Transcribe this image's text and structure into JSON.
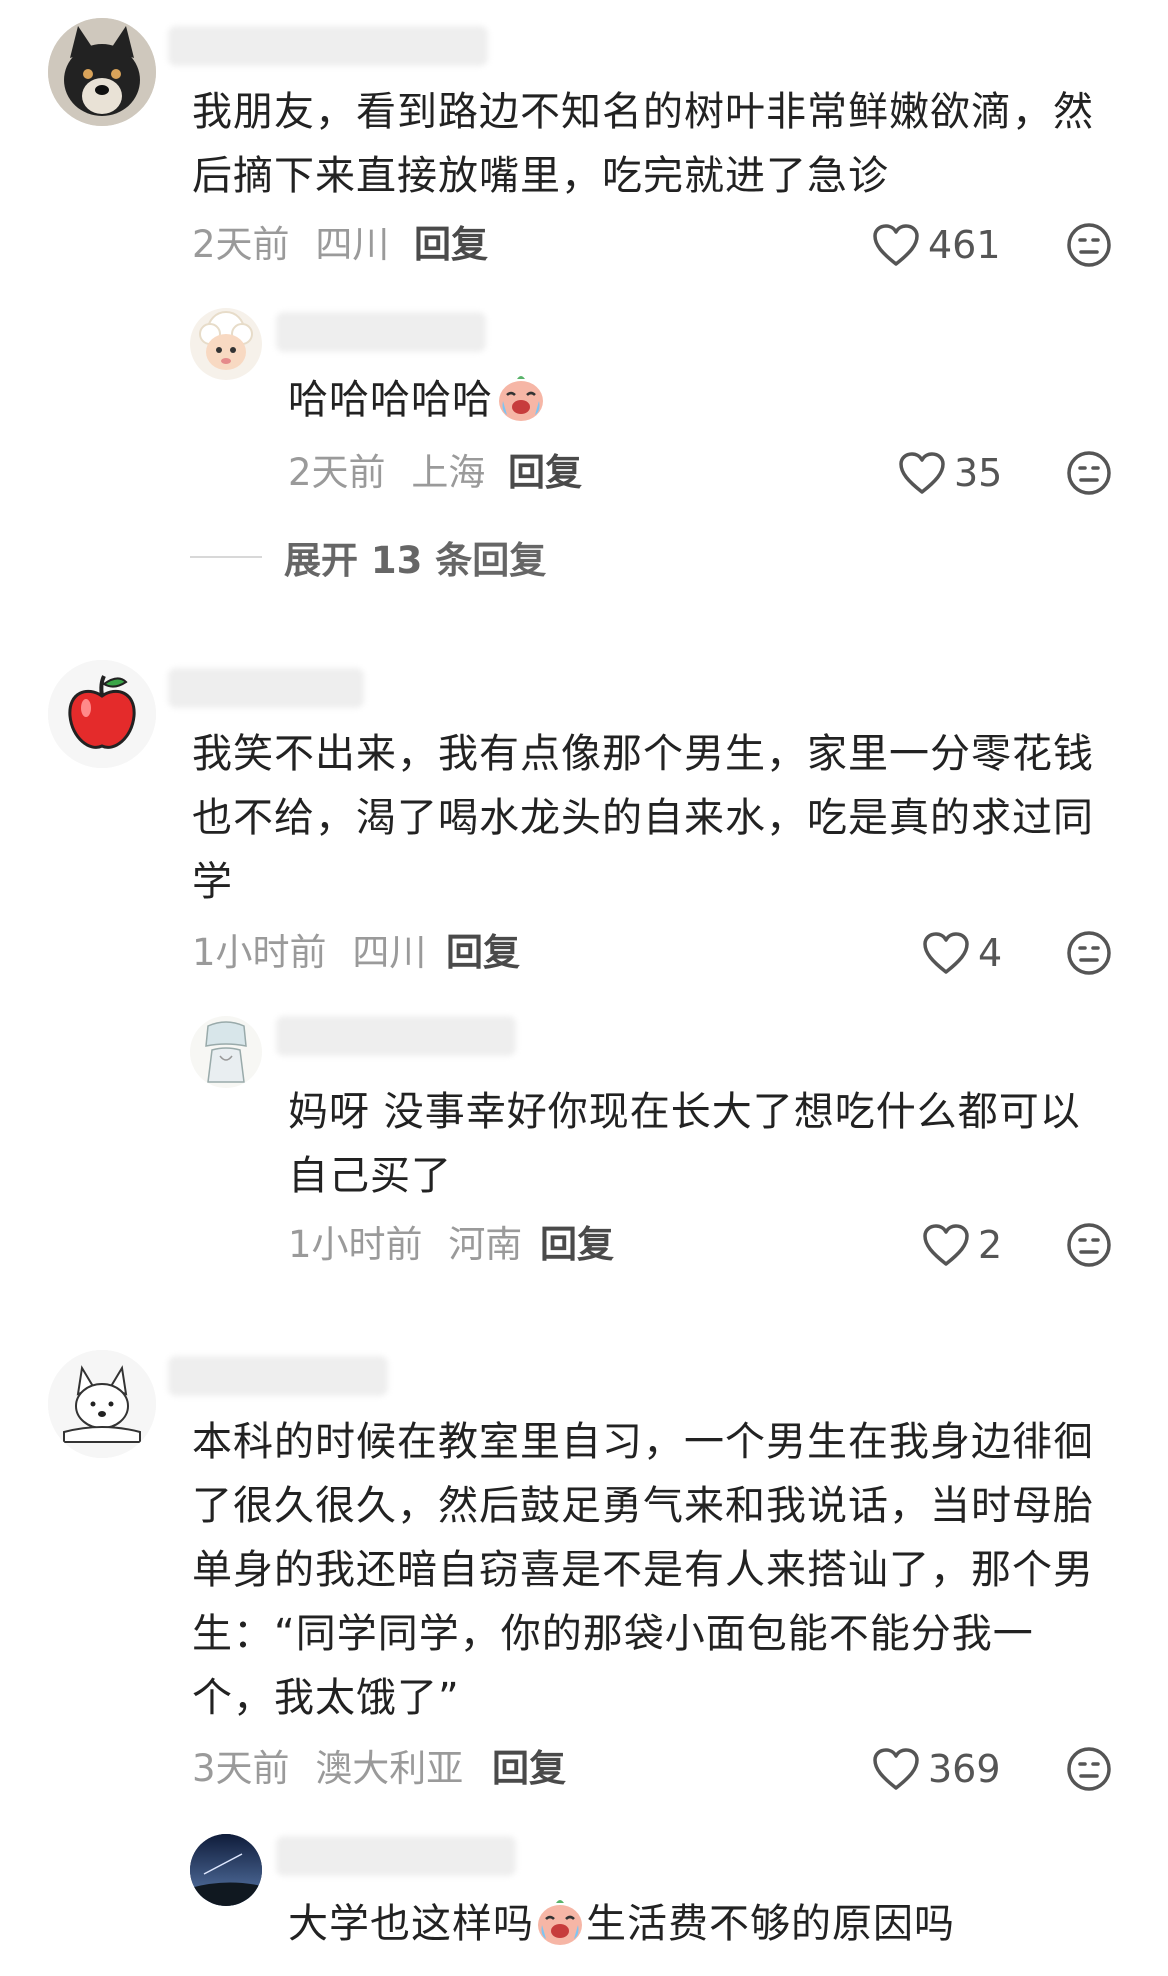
{
  "comments": [
    {
      "avatar": "shiba-dog-avatar",
      "text": "我朋友，看到路边不知名的树叶非常鲜嫩欲滴，然后摘下来直接放嘴里，吃完就进了急诊",
      "time": "2天前",
      "location": "四川",
      "reply_label": "回复",
      "likes": "461",
      "replies": [
        {
          "avatar": "cartoon-sheep-avatar",
          "text": "哈哈哈哈哈",
          "emoji": "crying-laughing-emoji",
          "time": "2天前",
          "location": "上海",
          "reply_label": "回复",
          "likes": "35"
        }
      ],
      "expand_label": "展开 13 条回复"
    },
    {
      "avatar": "apple-avatar",
      "text": "我笑不出来，我有点像那个男生，家里一分零花钱也不给，渴了喝水龙头的自来水，吃是真的求过同学",
      "time": "1小时前",
      "location": "四川",
      "reply_label": "回复",
      "likes": "4",
      "replies": [
        {
          "avatar": "sketch-girl-avatar",
          "text": "妈呀 没事幸好你现在长大了想吃什么都可以自己买了",
          "time": "1小时前",
          "location": "河南",
          "reply_label": "回复",
          "likes": "2"
        }
      ]
    },
    {
      "avatar": "white-dog-sketch-avatar",
      "text": "本科的时候在教室里自习，一个男生在我身边徘徊了很久很久，然后鼓足勇气来和我说话，当时母胎单身的我还暗自窃喜是不是有人来搭讪了，那个男生：“同学同学，你的那袋小面包能不能分我一个，我太饿了”",
      "time": "3天前",
      "location": "澳大利亚",
      "reply_label": "回复",
      "likes": "369",
      "replies": [
        {
          "avatar": "night-sky-avatar",
          "text_before_emoji": "大学也这样吗",
          "emoji": "crying-laughing-emoji",
          "text_after_emoji": "生活费不够的原因吗"
        }
      ]
    }
  ],
  "icons": {
    "like": "heart-outline-icon",
    "dislike": "meh-face-icon"
  },
  "colors": {
    "meta_gray": "#9a9a9a",
    "text": "#222222"
  }
}
